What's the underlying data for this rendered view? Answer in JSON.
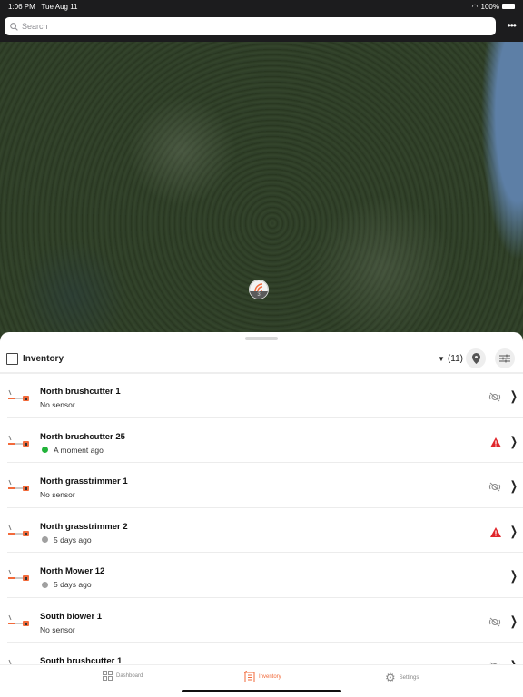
{
  "status": {
    "time": "1:06 PM",
    "date": "Tue Aug 11",
    "battery": "100%"
  },
  "search": {
    "placeholder": "Search"
  },
  "map": {
    "cluster_count": "3",
    "water_color": "#5d7fa6"
  },
  "inventory": {
    "title": "Inventory",
    "count": "(11)",
    "items": [
      {
        "name": "North brushcutter 1",
        "status": "No sensor",
        "dot": null,
        "indicator": "no-sensor-icon"
      },
      {
        "name": "North brushcutter 25",
        "status": "A moment ago",
        "dot": "#22b33a",
        "indicator": "warning-icon"
      },
      {
        "name": "North grasstrimmer 1",
        "status": "No sensor",
        "dot": null,
        "indicator": "no-sensor-icon"
      },
      {
        "name": "North grasstrimmer 2",
        "status": "5 days ago",
        "dot": "#a0a0a0",
        "indicator": "warning-icon"
      },
      {
        "name": "North Mower 12",
        "status": "5 days ago",
        "dot": "#a0a0a0",
        "indicator": null
      },
      {
        "name": "South blower 1",
        "status": "No sensor",
        "dot": null,
        "indicator": "no-sensor-icon"
      },
      {
        "name": "South brushcutter 1",
        "status": "",
        "dot": null,
        "indicator": "no-sensor-icon"
      }
    ]
  },
  "tabs": [
    {
      "label": "Dashboard"
    },
    {
      "label": "Inventory",
      "active": true
    },
    {
      "label": "Settings"
    }
  ],
  "colors": {
    "accent": "#f26a3a",
    "warning": "#e0262b"
  }
}
